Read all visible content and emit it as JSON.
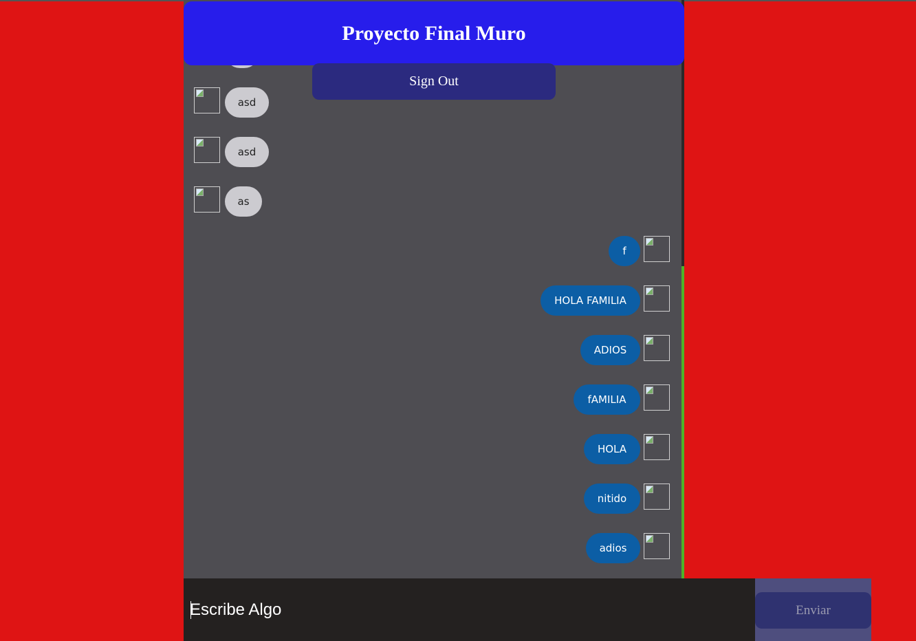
{
  "header": {
    "title": "Proyecto Final Muro"
  },
  "auth": {
    "sign_out_label": "Sign Out"
  },
  "messages_received": [
    {
      "text": ""
    },
    {
      "text": "asd"
    },
    {
      "text": "asd"
    },
    {
      "text": "as"
    }
  ],
  "messages_sent": [
    {
      "text": "f"
    },
    {
      "text": "HOLA FAMILIA"
    },
    {
      "text": "ADIOS"
    },
    {
      "text": "fAMILIA"
    },
    {
      "text": "HOLA"
    },
    {
      "text": "nitido"
    },
    {
      "text": "adios"
    }
  ],
  "composer": {
    "placeholder": "Escribe Algo",
    "send_label": "Enviar"
  },
  "colors": {
    "background": "#df1414",
    "header": "#271deb",
    "sent_bubble": "#0c5ea5",
    "received_bubble": "#cccbd0",
    "scroll_thumb": "#4fb228"
  }
}
